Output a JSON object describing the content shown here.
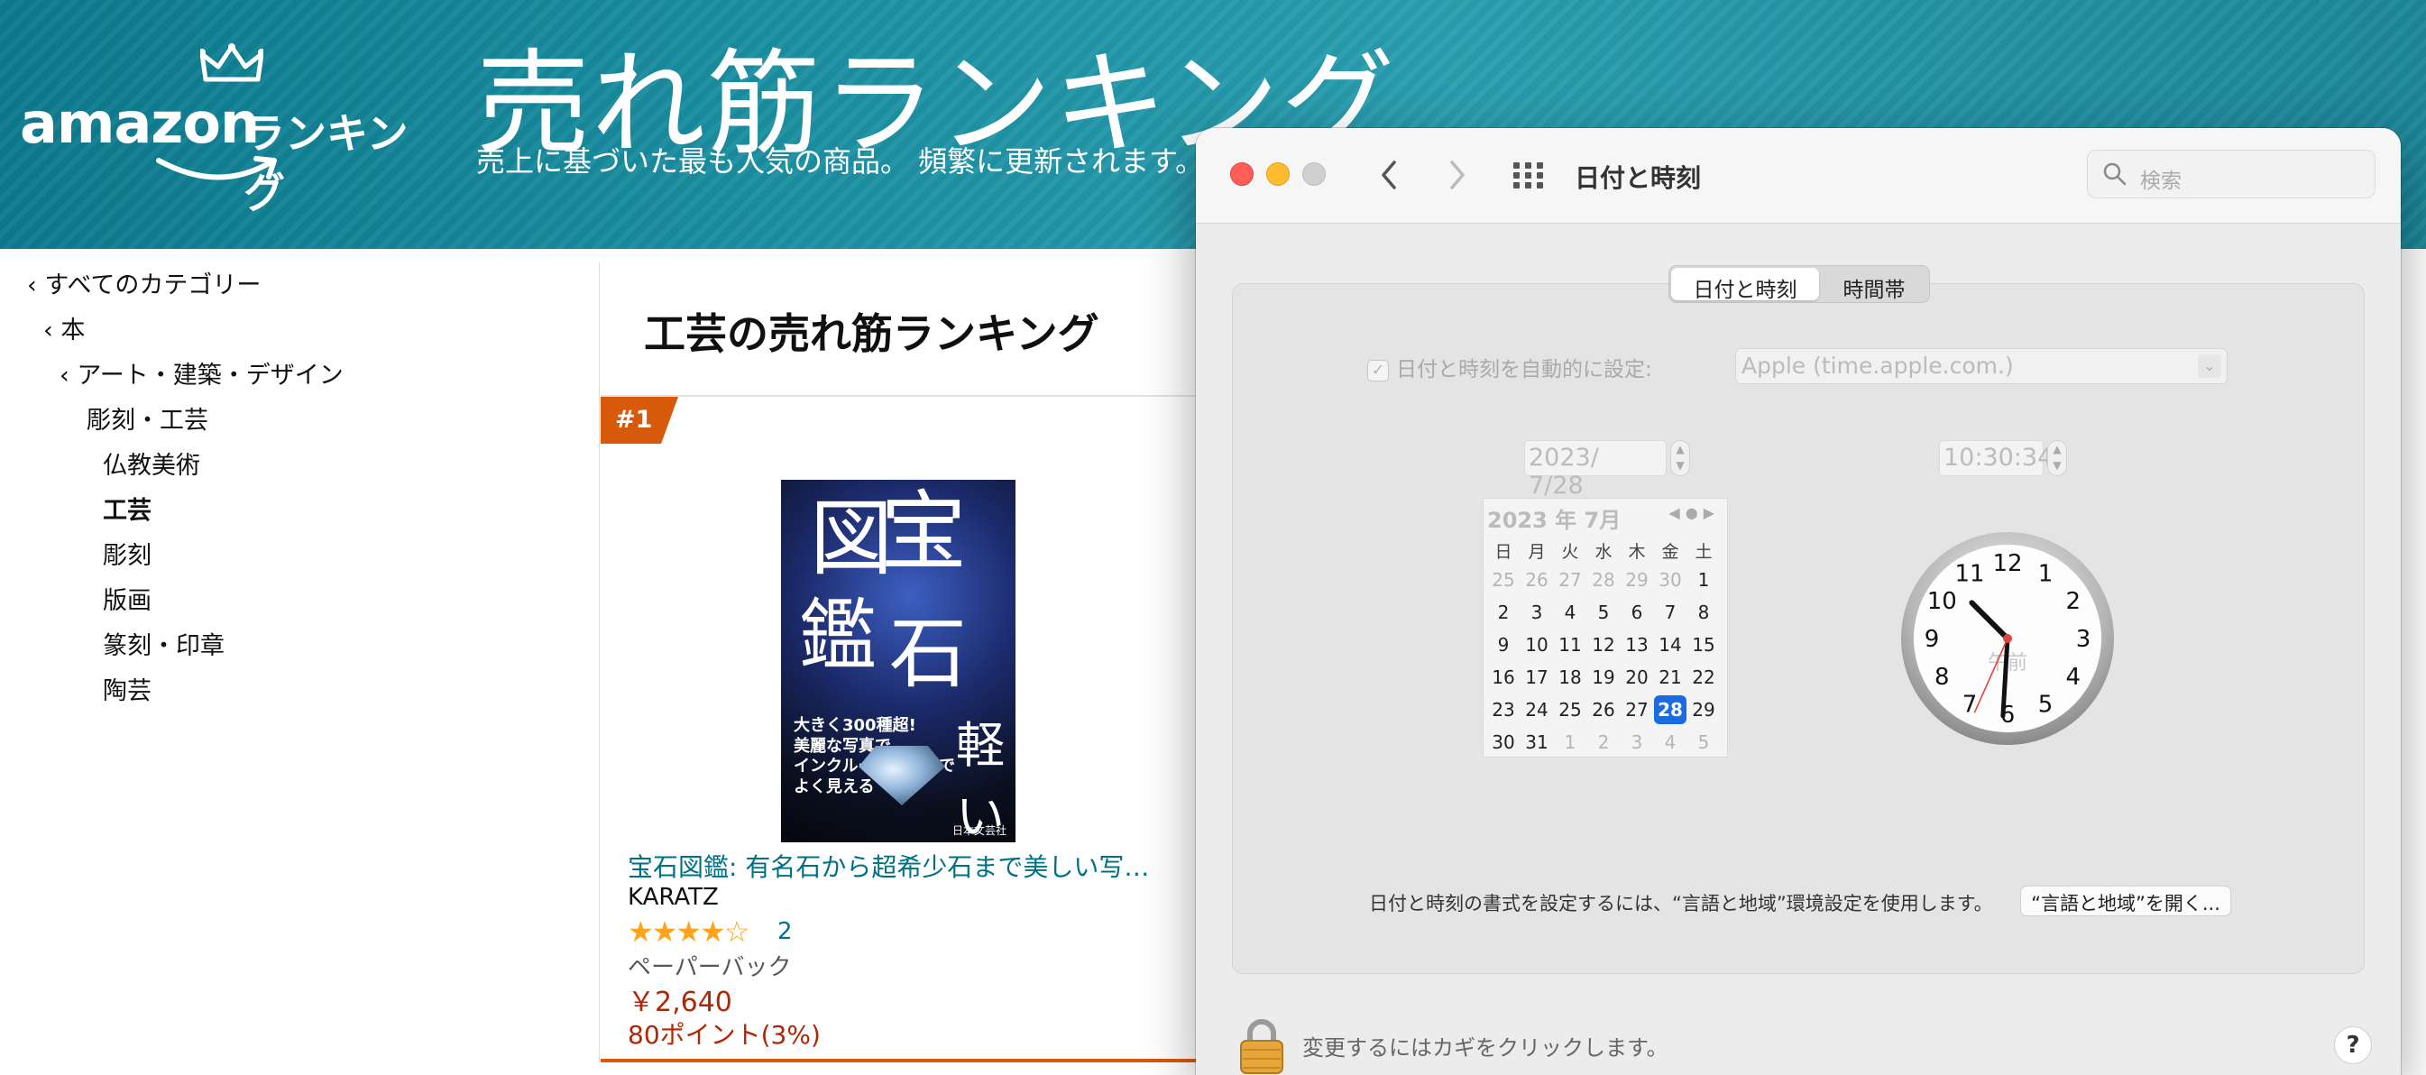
{
  "banner": {
    "logo_word": "amazon",
    "logo_rank": "ランキング",
    "title": "売れ筋ランキング",
    "subtitle": "売上に基づいた最も人気の商品。 頻繁に更新されます。"
  },
  "sidebar": {
    "items": [
      {
        "label": "‹ すべてのカテゴリー"
      },
      {
        "label": "‹ 本"
      },
      {
        "label": "‹ アート・建築・デザイン"
      },
      {
        "label": "彫刻・工芸"
      },
      {
        "label": "仏教美術"
      },
      {
        "label": "工芸"
      },
      {
        "label": "彫刻"
      },
      {
        "label": "版画"
      },
      {
        "label": "篆刻・印章"
      },
      {
        "label": "陶芸"
      }
    ]
  },
  "main": {
    "heading": "工芸の売れ筋ランキング",
    "rank_badge": "#1",
    "product": {
      "cover": {
        "c1": "図",
        "c2": "宝",
        "c3": "鑑",
        "c4": "石",
        "note": "大きく300種超!\n美麗な写真で\nインクルージョンまで\nよく見える",
        "light": "軽い",
        "publisher": "日本文芸社"
      },
      "title": "宝石図鑑: 有名石から超希少石まで美しい写…",
      "author": "KARATZ",
      "stars": "★★★★☆",
      "rating_count": "2",
      "format": "ペーパーバック",
      "price": "￥2,640",
      "points": "80ポイント(3%)"
    }
  },
  "prefs": {
    "title": "日付と時刻",
    "search_placeholder": "検索",
    "tabs": [
      "日付と時刻",
      "時間帯"
    ],
    "auto_label": "日付と時刻を自動的に設定:",
    "server": "Apple (time.apple.com.)",
    "date_value": "2023/  7/28",
    "time_value": "10:30:34",
    "calendar": {
      "month_label": "2023 年 7月",
      "weekdays": [
        "日",
        "月",
        "火",
        "水",
        "木",
        "金",
        "土"
      ],
      "rows": [
        [
          "25",
          "26",
          "27",
          "28",
          "29",
          "30",
          "1"
        ],
        [
          "2",
          "3",
          "4",
          "5",
          "6",
          "7",
          "8"
        ],
        [
          "9",
          "10",
          "11",
          "12",
          "13",
          "14",
          "15"
        ],
        [
          "16",
          "17",
          "18",
          "19",
          "20",
          "21",
          "22"
        ],
        [
          "23",
          "24",
          "25",
          "26",
          "27",
          "28",
          "29"
        ],
        [
          "30",
          "31",
          "1",
          "2",
          "3",
          "4",
          "5"
        ]
      ],
      "selected": "28"
    },
    "clock": {
      "numerals": [
        "12",
        "1",
        "2",
        "3",
        "4",
        "5",
        "6",
        "7",
        "8",
        "9",
        "10",
        "11"
      ],
      "ampm": "午前",
      "hour": 10,
      "minute": 30,
      "second": 34
    },
    "format_note": "日付と時刻の書式を設定するには、“言語と地域”環境設定を使用します。",
    "open_button": "“言語と地域”を開く...",
    "lock_text": "変更するにはカギをクリックします。",
    "help": "?"
  },
  "colors": {
    "banner": "#1a8ea0",
    "link": "#007185",
    "price": "#b12704",
    "badge": "#d65a0a",
    "selected_day": "#1a6ce0"
  }
}
